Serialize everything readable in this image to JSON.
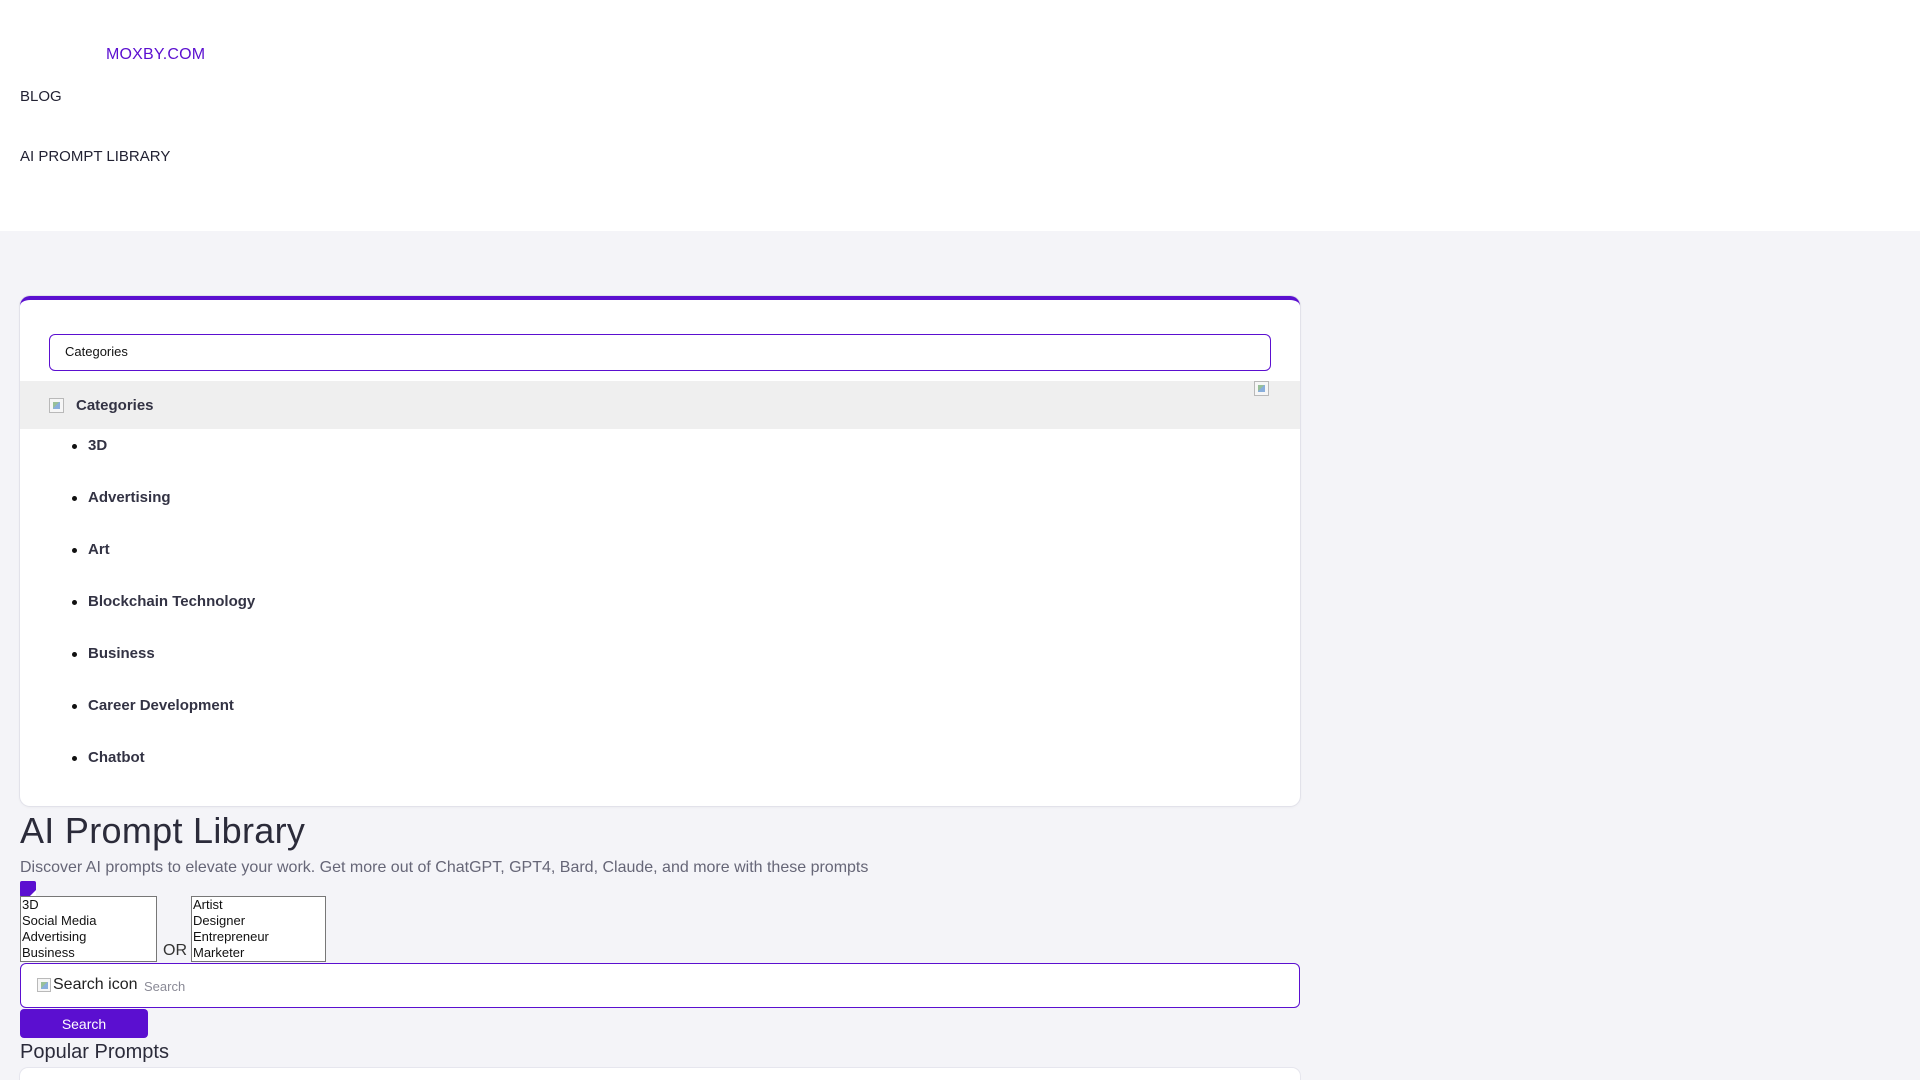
{
  "header": {
    "brand": "MOXBY.COM",
    "nav": [
      {
        "label": "BLOG"
      },
      {
        "label": "AI PROMPT LIBRARY"
      }
    ]
  },
  "categories_panel": {
    "select_value": "Categories",
    "header_title": "Categories",
    "items": [
      "3D",
      "Advertising",
      "Art",
      "Blockchain Technology",
      "Business",
      "Career Development",
      "Chatbot"
    ],
    "accent_color": "#5b0fd0"
  },
  "main": {
    "title": "AI Prompt Library",
    "subtitle": "Discover AI prompts to elevate your work. Get more out of ChatGPT, GPT4, Bard, Claude, and more with these prompts",
    "category_options": [
      "3D",
      "Social Media",
      "Advertising",
      "Business"
    ],
    "or_label": "OR",
    "role_options": [
      "Artist",
      "Designer",
      "Entrepreneur",
      "Marketer"
    ],
    "search": {
      "icon_alt": "Search icon",
      "placeholder": "Search",
      "button_label": "Search"
    },
    "popular_title": "Popular Prompts"
  }
}
